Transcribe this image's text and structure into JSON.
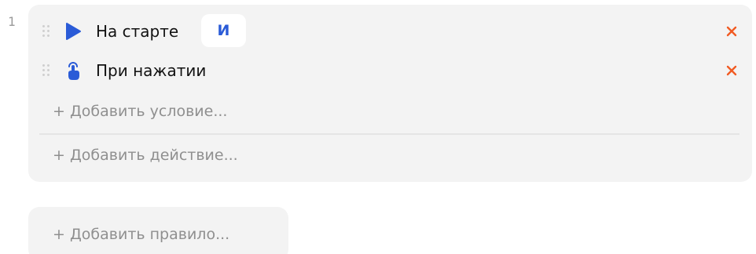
{
  "rule": {
    "number": "1",
    "conditions": [
      {
        "icon": "play-icon",
        "label": "На старте",
        "connector": "И"
      },
      {
        "icon": "tap-hand-icon",
        "label": "При нажатии"
      }
    ],
    "add_condition_label": "+ Добавить условие...",
    "add_action_label": "+ Добавить действие..."
  },
  "add_rule_label": "+ Добавить правило...",
  "colors": {
    "accent": "#2a5bd7",
    "remove": "#f15a22",
    "card_bg": "#f3f3f3",
    "muted_text": "#8f8f8f"
  }
}
